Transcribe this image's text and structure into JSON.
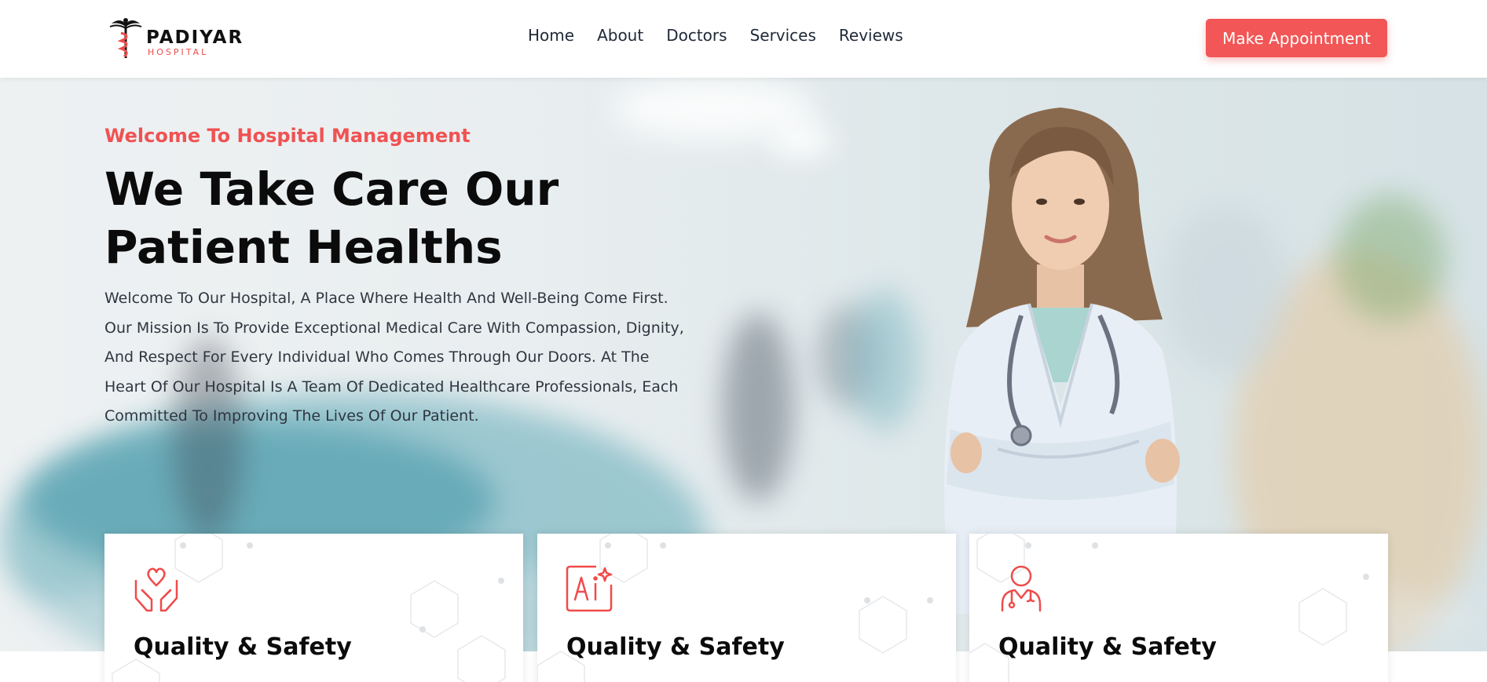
{
  "header": {
    "logo_word": "PADIYAR",
    "logo_sub": "HOSPITAL",
    "nav": [
      "Home",
      "About",
      "Doctors",
      "Services",
      "Reviews"
    ],
    "cta_label": "Make Appointment"
  },
  "hero": {
    "welcome": "Welcome To Hospital Management",
    "headline_line1": "We Take Care Our",
    "headline_line2": "Patient Healths",
    "paragraph": "Welcome To Our Hospital, A Place Where Health And Well-Being Come First. Our Mission Is To Provide Exceptional Medical Care With Compassion, Dignity, And Respect For Every Individual Who Comes Through Our Doors. At The Heart Of Our Hospital Is A Team Of Dedicated Healthcare Professionals, Each Committed To Improving The Lives Of Our Patient."
  },
  "cards": [
    {
      "title": "Quality & Safety",
      "icon": "heart-hands-icon"
    },
    {
      "title": "Quality & Safety",
      "icon": "ai-icon"
    },
    {
      "title": "Quality & Safety",
      "icon": "doctor-icon"
    }
  ],
  "colors": {
    "accent": "#f25656",
    "heading": "#0b0b0b",
    "text": "#2f3640"
  }
}
